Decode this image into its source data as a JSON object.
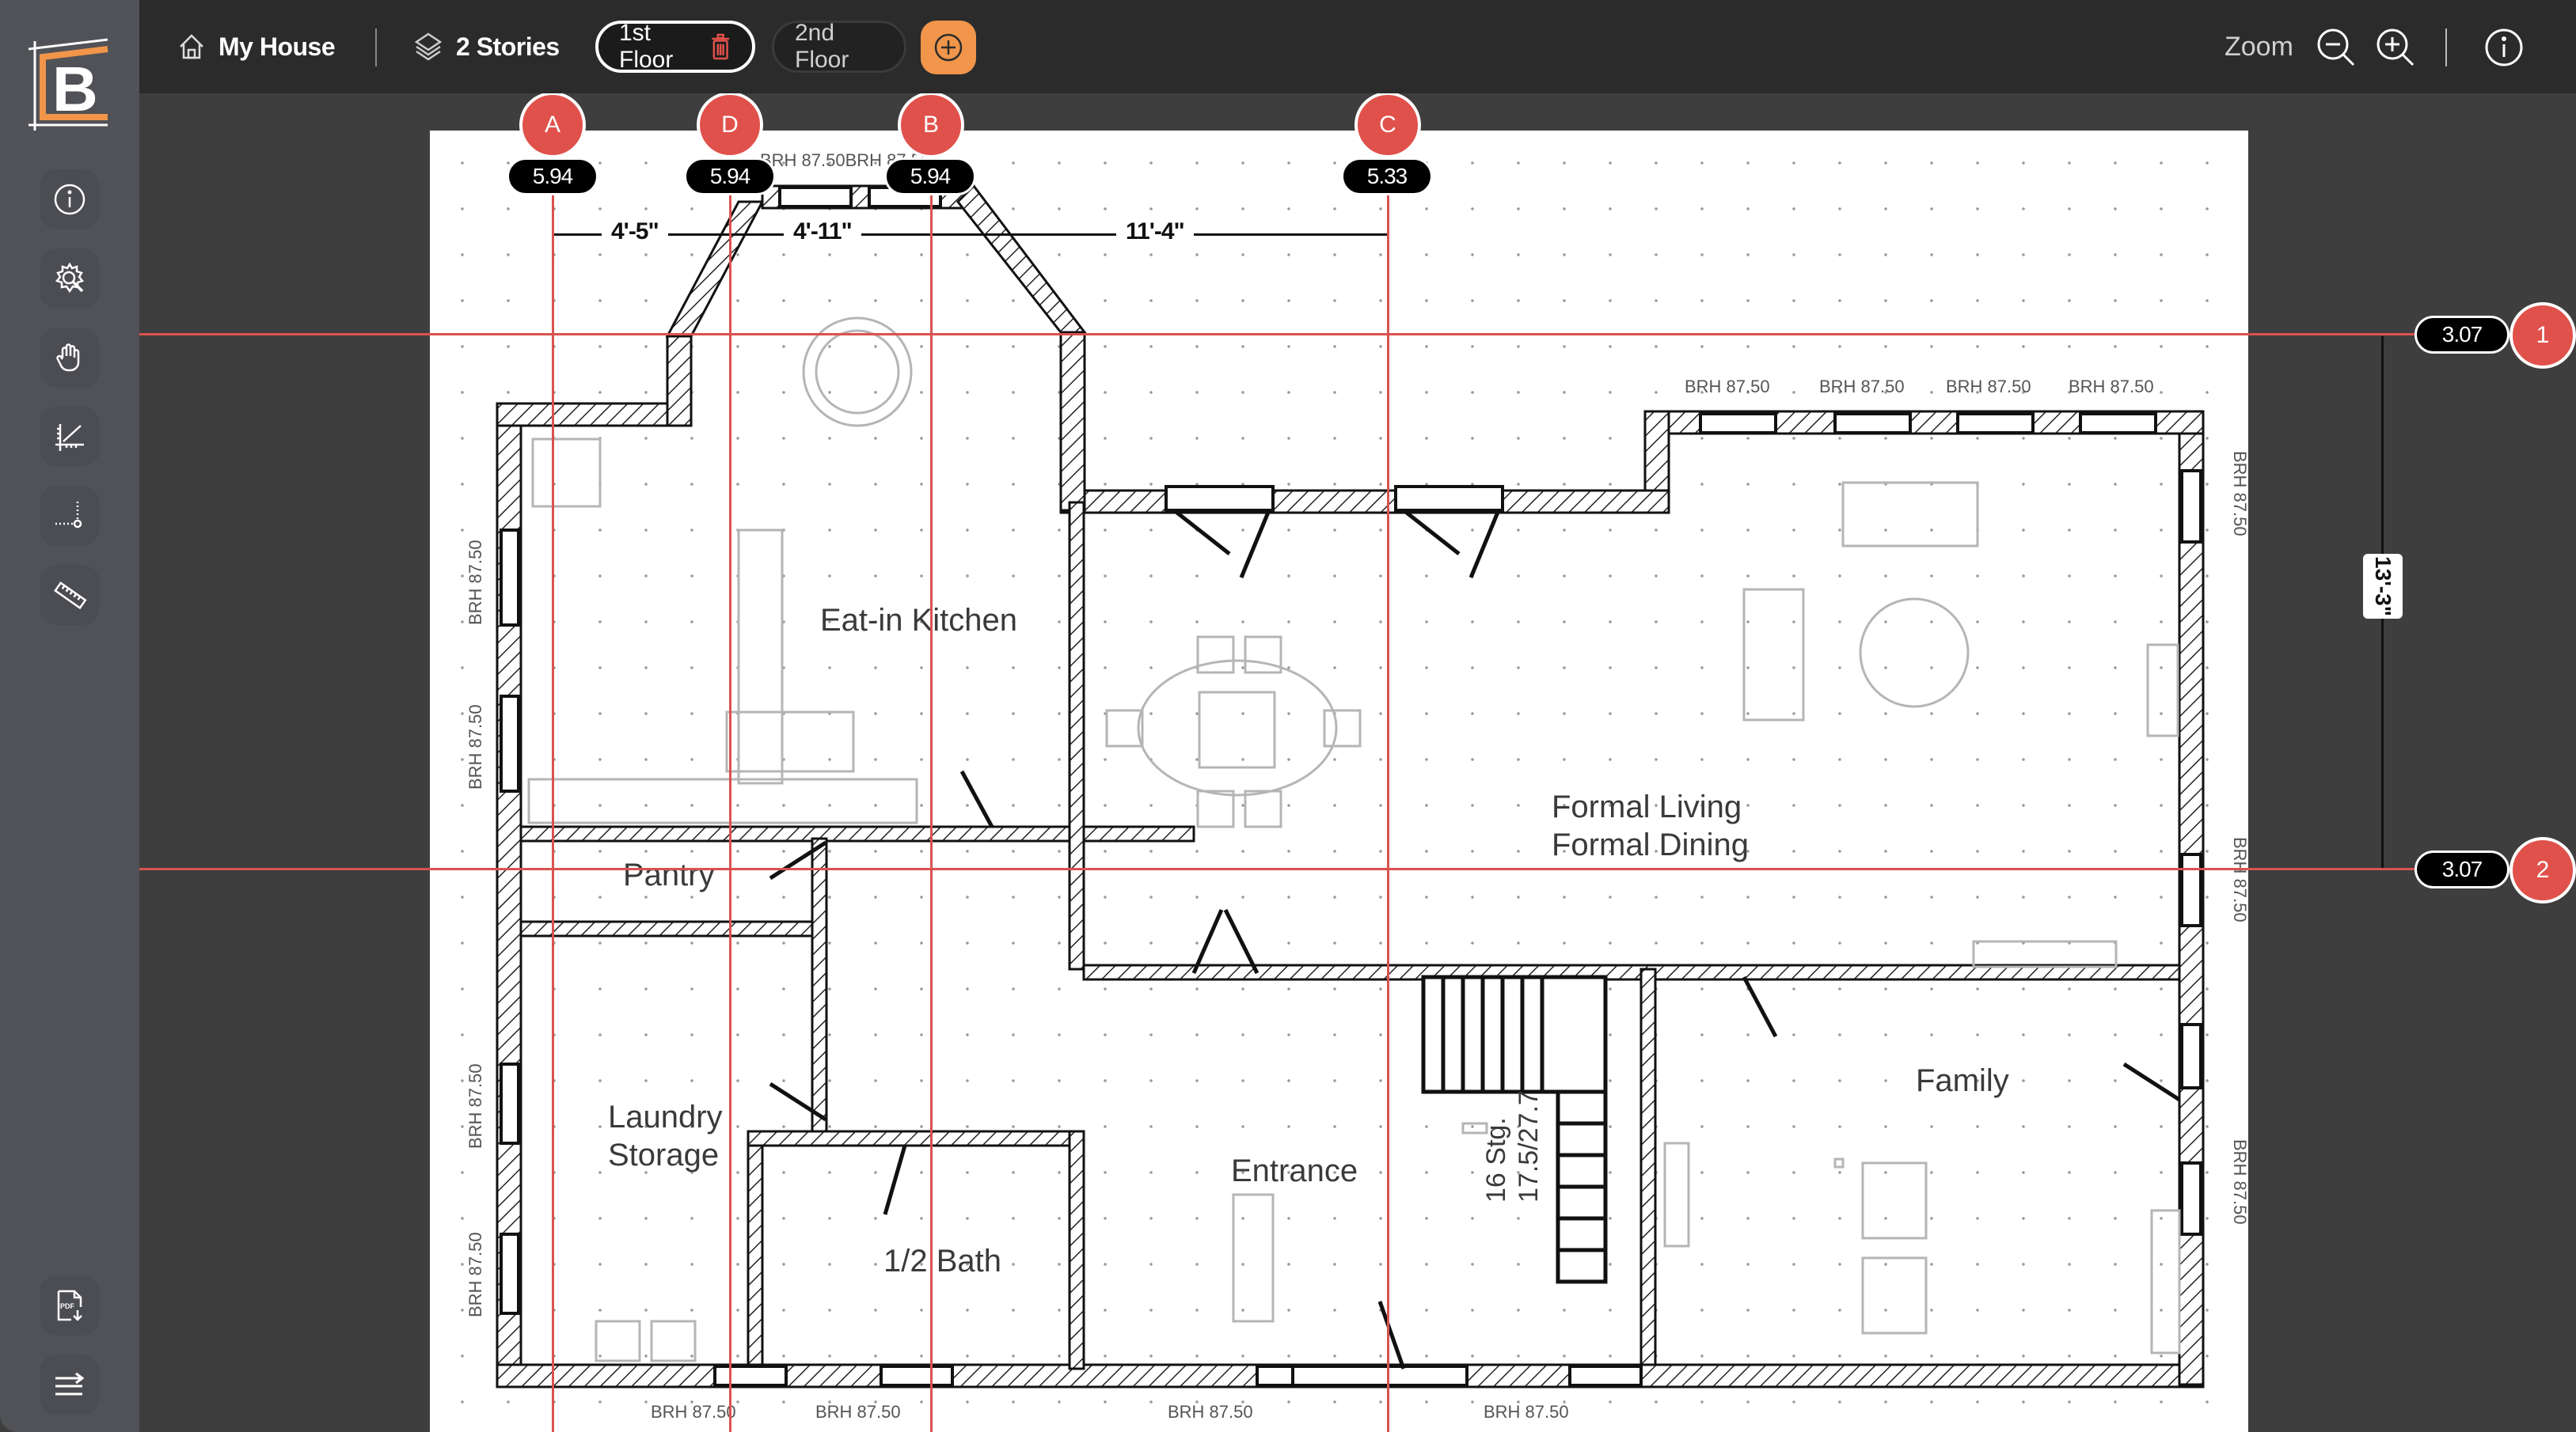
{
  "app": {
    "logo_letter": "B",
    "accent_color": "#f0954a",
    "marker_color": "#e0514b"
  },
  "toolbar": {
    "project_name": "My House",
    "stories_label": "2 Stories",
    "floors": [
      {
        "label": "1st Floor",
        "active": true,
        "deletable": true
      },
      {
        "label": "2nd Floor",
        "active": false,
        "deletable": false
      }
    ],
    "add_floor_icon": "plus-circle-icon",
    "zoom_label": "Zoom",
    "zoom_out_icon": "zoom-out-icon",
    "zoom_in_icon": "zoom-in-icon",
    "info_icon": "info-icon"
  },
  "sidebar": {
    "tools": [
      {
        "name": "info",
        "icon": "info-icon"
      },
      {
        "name": "settings-search",
        "icon": "gear-search-icon"
      },
      {
        "name": "pan",
        "icon": "hand-icon"
      },
      {
        "name": "scale",
        "icon": "scale-angle-icon"
      },
      {
        "name": "point-measure",
        "icon": "dotted-corner-icon"
      },
      {
        "name": "ruler",
        "icon": "ruler-icon"
      }
    ],
    "bottom_tools": [
      {
        "name": "export-pdf",
        "icon": "pdf-download-icon",
        "label": "PDF"
      },
      {
        "name": "menu",
        "icon": "menu-arrow-icon"
      }
    ]
  },
  "grid": {
    "vertical_lines": [
      {
        "id": "A",
        "value": "5.94"
      },
      {
        "id": "D",
        "value": "5.94"
      },
      {
        "id": "B",
        "value": "5.94"
      },
      {
        "id": "C",
        "value": "5.33"
      }
    ],
    "horizontal_lines": [
      {
        "id": "1",
        "value": "3.07"
      },
      {
        "id": "2",
        "value": "3.07"
      }
    ],
    "horizontal_dimensions": [
      "4'-5\"",
      "4'-11\"",
      "11'-4\""
    ],
    "vertical_dimension": "13'-3\""
  },
  "floor_plan": {
    "rooms": [
      {
        "name": "Eat-in Kitchen"
      },
      {
        "name": "Pantry"
      },
      {
        "name": "Laundry\nStorage",
        "line1": "Laundry",
        "line2": "Storage"
      },
      {
        "name": "1/2 Bath"
      },
      {
        "name": "Entrance"
      },
      {
        "name": "Formal Living Formal Dining",
        "line1": "Formal Living",
        "line2": "Formal Dining"
      },
      {
        "name": "Family"
      }
    ],
    "stairs_label": {
      "line1": "16 Stg.",
      "line2": "17.5/27.7"
    },
    "window_label": "BRH 87.50",
    "window_label_combined": "BRH 87.50BRH 87.50"
  }
}
